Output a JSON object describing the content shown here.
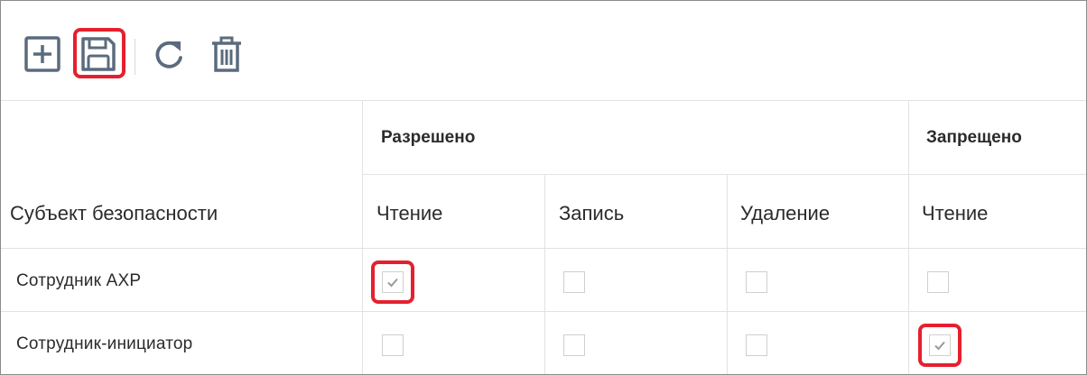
{
  "toolbar": {
    "buttons": [
      {
        "icon": "plus-square-icon"
      },
      {
        "icon": "floppy-disk-icon"
      },
      {
        "icon": "refresh-icon"
      },
      {
        "icon": "trash-icon"
      }
    ],
    "highlight_color": "#e5202e",
    "icon_color": "#5b6b7e"
  },
  "table": {
    "group_headers": {
      "allowed": "Разрешено",
      "denied": "Запрещено"
    },
    "subject_header": "Субъект безопасности",
    "columns": {
      "allowed_read": "Чтение",
      "allowed_write": "Запись",
      "allowed_delete": "Удаление",
      "denied_read": "Чтение"
    },
    "rows": [
      {
        "subject": "Сотрудник АХР",
        "allowed_read": true,
        "allowed_write": false,
        "allowed_delete": false,
        "denied_read": false
      },
      {
        "subject": "Сотрудник-инициатор",
        "allowed_read": false,
        "allowed_write": false,
        "allowed_delete": false,
        "denied_read": true
      }
    ]
  }
}
